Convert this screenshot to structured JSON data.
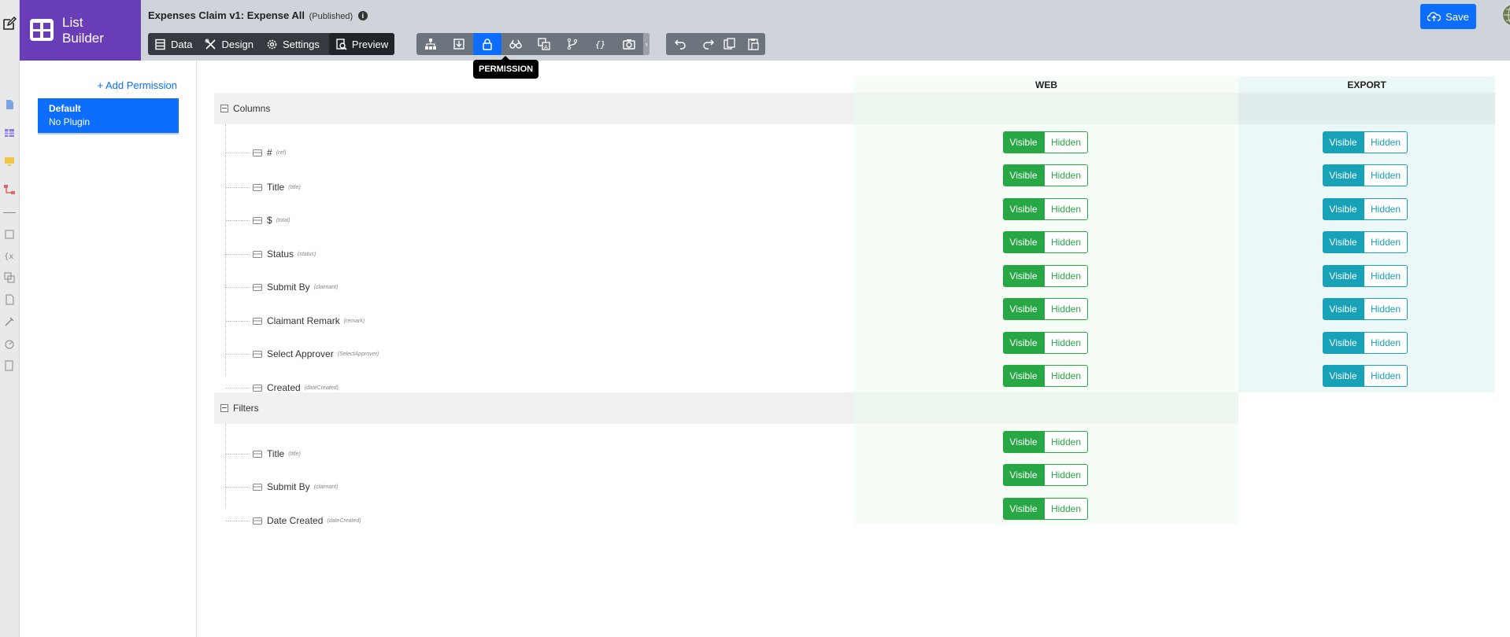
{
  "app": {
    "logo_line1": "List",
    "logo_line2": "Builder"
  },
  "header": {
    "title": "Expenses Claim v1: Expense All",
    "status": "(Published)",
    "info_icon": "info-icon"
  },
  "nav": {
    "data": "Data",
    "design": "Design",
    "settings": "Settings",
    "preview": "Preview"
  },
  "toolbar": {
    "tools": [
      "hierarchy-icon",
      "import-icon",
      "lock-icon",
      "binoculars-icon",
      "translate-icon",
      "branch-icon",
      "code-braces-icon",
      "camera-icon"
    ],
    "active_tool": "lock-icon",
    "tooltip": "PERMISSION",
    "more": "›"
  },
  "actions": {
    "save": "Save"
  },
  "permissions": {
    "add_label": "Add Permission",
    "items": [
      {
        "name": "Default",
        "plugin": "No Plugin"
      }
    ]
  },
  "grid": {
    "col_web": "WEB",
    "col_export": "EXPORT",
    "visible_label": "Visible",
    "hidden_label": "Hidden",
    "sections": [
      {
        "label": "Columns",
        "rows": [
          {
            "name": "#",
            "key": "(ref)",
            "web": "Visible",
            "export": "Visible"
          },
          {
            "name": "Title",
            "key": "(title)",
            "web": "Visible",
            "export": "Visible"
          },
          {
            "name": "$",
            "key": "(total)",
            "web": "Visible",
            "export": "Visible"
          },
          {
            "name": "Status",
            "key": "(status)",
            "web": "Visible",
            "export": "Visible"
          },
          {
            "name": "Submit By",
            "key": "(claimant)",
            "web": "Visible",
            "export": "Visible"
          },
          {
            "name": "Claimant Remark",
            "key": "(remark)",
            "web": "Visible",
            "export": "Visible"
          },
          {
            "name": "Select Approver",
            "key": "(SelectApprover)",
            "web": "Visible",
            "export": "Visible"
          },
          {
            "name": "Created",
            "key": "(dateCreated)",
            "web": "Visible",
            "export": "Visible"
          }
        ]
      },
      {
        "label": "Filters",
        "rows": [
          {
            "name": "Title",
            "key": "(title)",
            "web": "Visible"
          },
          {
            "name": "Submit By",
            "key": "(claimant)",
            "web": "Visible"
          },
          {
            "name": "Date Created",
            "key": "(dateCreated)",
            "web": "Visible"
          }
        ]
      }
    ]
  },
  "colors": {
    "brand": "#6a3db8",
    "primary": "#0d6efd",
    "web_green": "#28a745",
    "export_teal": "#17a2b8"
  }
}
